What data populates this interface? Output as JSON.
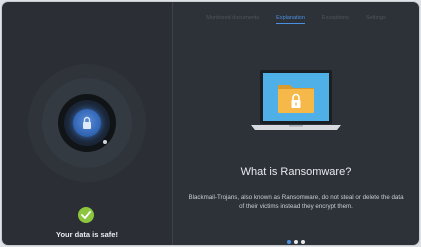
{
  "tabs": [
    {
      "label": "Monitored documents",
      "active": false
    },
    {
      "label": "Explanation",
      "active": true
    },
    {
      "label": "Exceptions",
      "active": false
    },
    {
      "label": "Settings",
      "active": false
    }
  ],
  "status": {
    "text": "Your data is safe!",
    "icon": "check-circle-icon",
    "color": "#8cc63f"
  },
  "shield": {
    "icon": "lock-icon",
    "accent": "#3d74c6"
  },
  "explanation": {
    "illustration": "laptop-folder-lock-icon",
    "title": "What is Ransomware?",
    "body": "Blackmail-Trojans, also known as Ransomware, do not steal or delete the data of their victims instead they encrypt them."
  },
  "pager": {
    "count": 3,
    "current": 1
  },
  "colors": {
    "accent": "#4a90e2",
    "left_bg": "#2b2f35",
    "right_bg": "#2d3238",
    "folder": "#f5b849",
    "screen": "#4fb0e8"
  }
}
